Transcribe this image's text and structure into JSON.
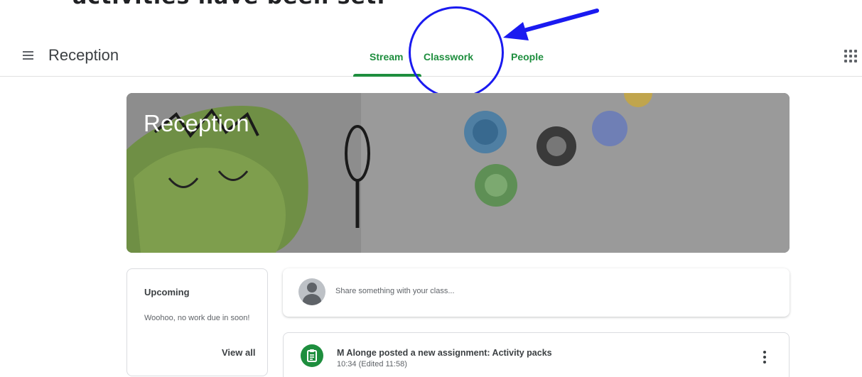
{
  "annotation": {
    "caption": "activities have been set."
  },
  "header": {
    "class_name": "Reception",
    "tabs": [
      {
        "label": "Stream",
        "active": true
      },
      {
        "label": "Classwork",
        "active": false
      },
      {
        "label": "People",
        "active": false
      }
    ]
  },
  "banner": {
    "title": "Reception"
  },
  "upcoming": {
    "title": "Upcoming",
    "message": "Woohoo, no work due in soon!",
    "view_all_label": "View all"
  },
  "share": {
    "placeholder": "Share something with your class..."
  },
  "posts": [
    {
      "title": "M Alonge posted a new assignment: Activity packs",
      "time": "10:34 (Edited 11:58)",
      "icon": "assignment-icon"
    }
  ],
  "colors": {
    "accent": "#1e8e3e",
    "annotation": "#1a1af0"
  }
}
